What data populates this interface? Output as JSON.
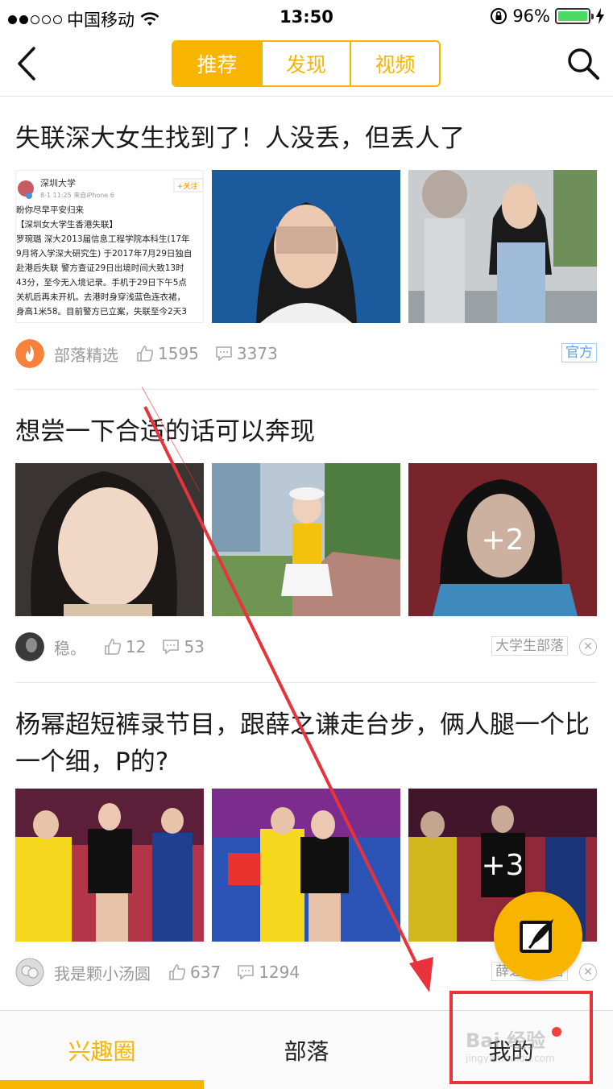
{
  "status_bar": {
    "carrier": "中国移动",
    "time": "13:50",
    "battery": "96%"
  },
  "nav": {
    "tabs": [
      {
        "label": "推荐",
        "active": true
      },
      {
        "label": "发现",
        "active": false
      },
      {
        "label": "视频",
        "active": false
      }
    ]
  },
  "posts": [
    {
      "title": "失联深大女生找到了！人没丢，但丢人了",
      "author": "部落精选",
      "likes": "1595",
      "comments": "3373",
      "tag": "官方",
      "more": ""
    },
    {
      "title": "想尝一下合适的话可以奔现",
      "author": "稳。",
      "likes": "12",
      "comments": "53",
      "tag": "大学生部落",
      "more": "+2"
    },
    {
      "title": "杨幂超短裤录节目，跟薛之谦走台步，俩人腿一个比一个细，P的?",
      "author": "我是颗小汤圆",
      "likes": "637",
      "comments": "1294",
      "tag": "薛之谦部落",
      "more": "+3"
    }
  ],
  "post1_screenshot": {
    "account": "深圳大学",
    "follow": "+关注",
    "meta": "8-1 11:25  来自iPhone 6",
    "lines": [
      "盼你尽早平安归来",
      "【深圳女大学生香港失联】",
      "罗琬璐 深大2013届信息工程学院本科生(17年",
      "9月将入学深大研究生) 于2017年7月29日独自",
      "赴港后失联 警方查证29日出境时间大致13时",
      "43分，至今无入境记录。手机于29日下午5点",
      "关机后再未开机。去港时身穿浅蓝色连衣裙，",
      "身高1米58。目前警方已立案，失联至今2天3"
    ]
  },
  "tab_bar": {
    "tabs": [
      {
        "label": "兴趣圈",
        "active": true
      },
      {
        "label": "部落",
        "active": false
      },
      {
        "label": "我的",
        "active": false
      }
    ]
  },
  "watermark": {
    "text": "Bai 经验",
    "url": "jingyan.baidu.com"
  },
  "colors": {
    "accent": "#f8b500",
    "annotation": "#e8333a",
    "badge_dot": "#f0413c"
  }
}
